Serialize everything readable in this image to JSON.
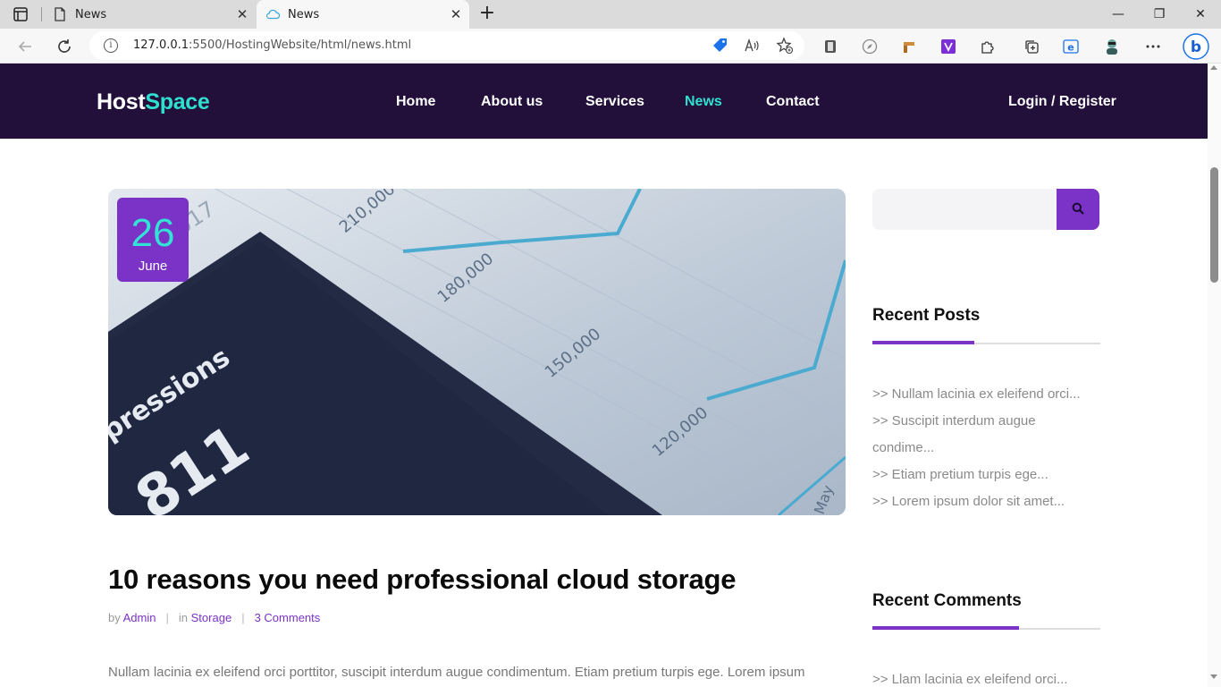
{
  "browser": {
    "tabs": [
      {
        "title": "News",
        "favicon": "page-icon"
      },
      {
        "title": "News",
        "favicon": "cloud-icon"
      }
    ],
    "new_tab_symbol": "+",
    "url_host": "127.0.0.1",
    "url_path": ":5500/HostingWebsite/html/news.html"
  },
  "site": {
    "logo_part1": "Host",
    "logo_part2": "Space",
    "nav": [
      "Home",
      "About us",
      "Services",
      "News",
      "Contact"
    ],
    "active_nav": "News",
    "login": "Login / Register"
  },
  "article": {
    "date_day": "26",
    "date_month": "June",
    "title": "10 reasons you need professional cloud storage",
    "meta_by": "by",
    "author": "Admin",
    "meta_in": "in",
    "category": "Storage",
    "comments": "3 Comments",
    "separator": "|",
    "excerpt": "Nullam lacinia ex eleifend orci porttitor, suscipit interdum augue condimentum. Etiam pretium turpis ege. Lorem ipsum",
    "image_texts": {
      "top": "2017",
      "v1": "210,000",
      "v2": "180,000",
      "v3": "150,000",
      "v4": "120,000",
      "side": "May",
      "impressions": "pressions",
      "big_number": "811"
    }
  },
  "sidebar": {
    "recent_posts_title": "Recent Posts",
    "recent_posts": [
      ">> Nullam lacinia ex eleifend orci...",
      ">> Suscipit interdum augue",
      "condime...",
      ">> Etiam pretium turpis ege...",
      ">> Lorem ipsum dolor sit amet..."
    ],
    "recent_comments_title": "Recent Comments",
    "recent_comments": [
      ">> Llam lacinia ex eleifend orci..."
    ]
  },
  "colors": {
    "header_bg": "#220f3a",
    "accent_teal": "#2fe0d0",
    "accent_purple": "#7a33c6"
  }
}
